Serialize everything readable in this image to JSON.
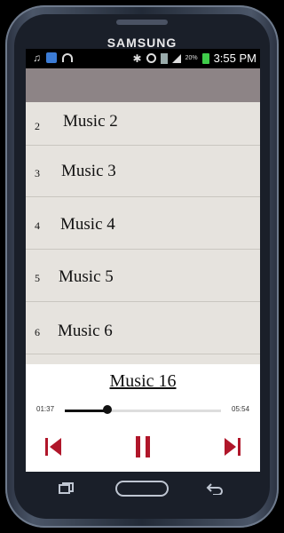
{
  "device": {
    "brand": "SAMSUNG"
  },
  "status_bar": {
    "battery_percent": "20%",
    "time": "3:55 PM"
  },
  "colors": {
    "accent": "#b0162a",
    "list_bg": "#e6e3de",
    "header_band": "#8d8486"
  },
  "playlist": {
    "items": [
      {
        "number": "2",
        "title": "Music 2"
      },
      {
        "number": "3",
        "title": "Music 3"
      },
      {
        "number": "4",
        "title": "Music 4"
      },
      {
        "number": "5",
        "title": "Music 5"
      },
      {
        "number": "6",
        "title": "Music 6"
      }
    ]
  },
  "player": {
    "now_playing": "Music 16",
    "elapsed": "01:37",
    "duration": "05:54",
    "progress": 0.274,
    "controls": {
      "previous_icon": "skip-previous-icon",
      "pause_icon": "pause-icon",
      "next_icon": "skip-next-icon"
    }
  }
}
